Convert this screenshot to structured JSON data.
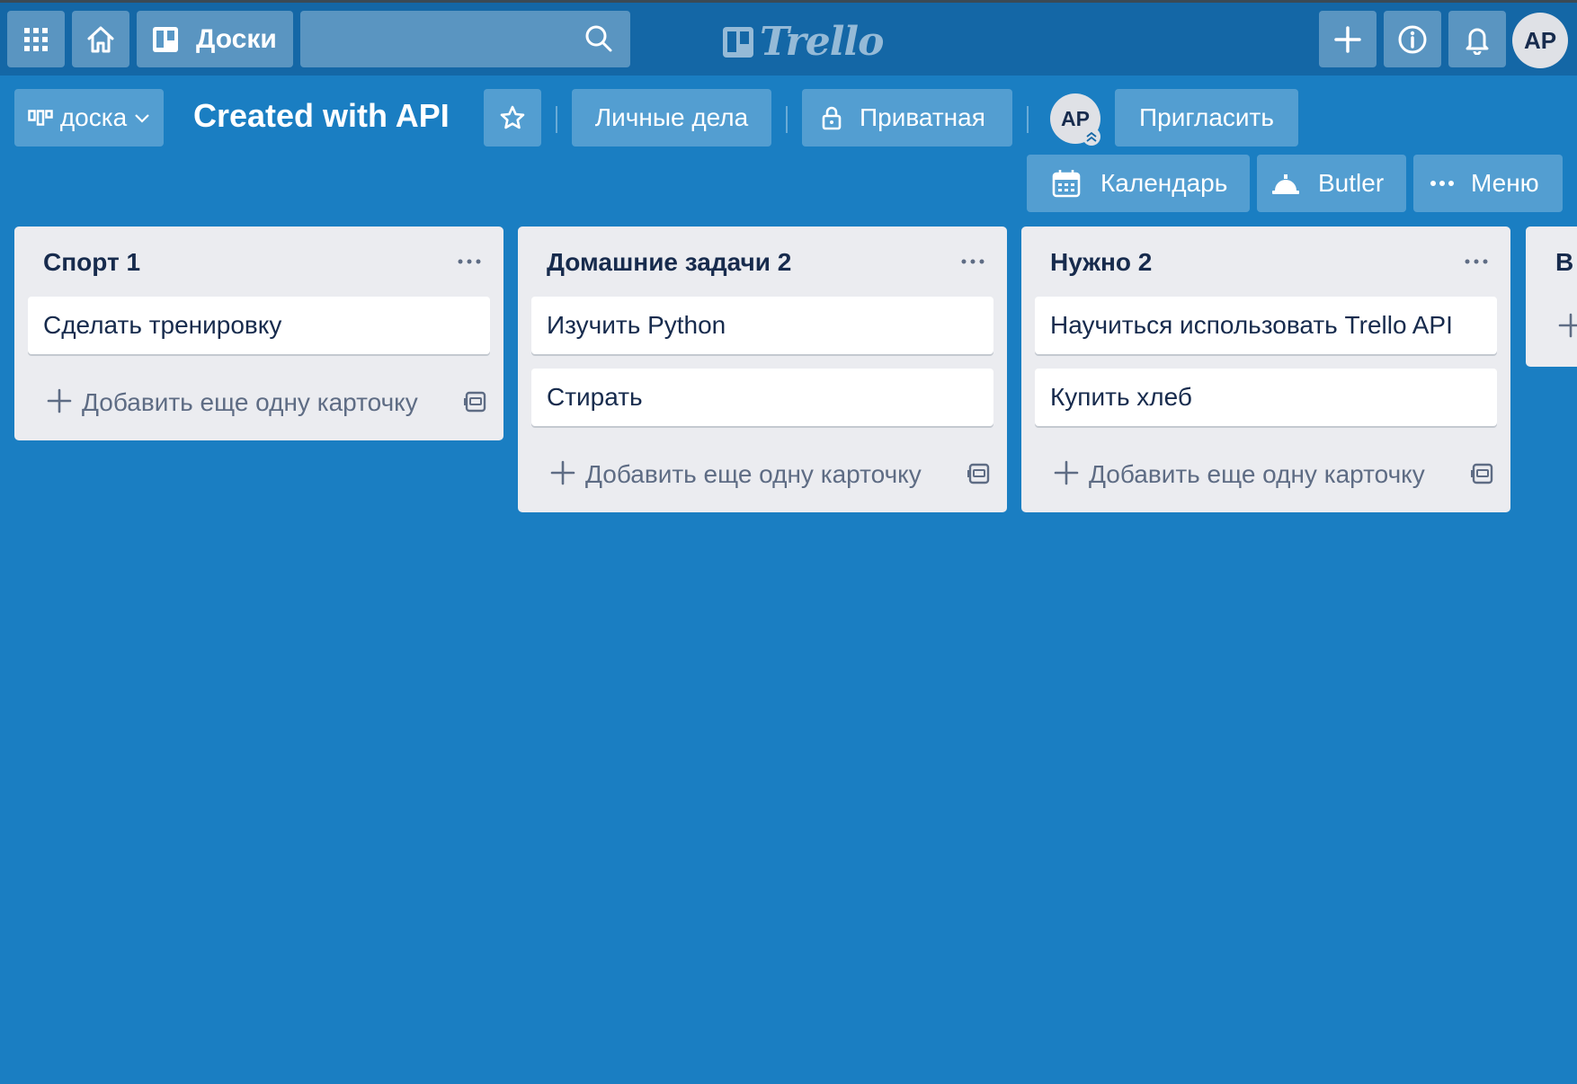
{
  "topbar": {
    "boards_label": "Доски",
    "search_value": "",
    "logo_text": "Trello",
    "user_initials": "AP"
  },
  "board": {
    "switcher_label": "доска",
    "title": "Created with API",
    "team_label": "Личные дела",
    "visibility_label": "Приватная",
    "member_initials": "AP",
    "invite_label": "Пригласить",
    "calendar_label": "Календарь",
    "butler_label": "Butler",
    "menu_label": "Меню"
  },
  "lists": [
    {
      "title": "Спорт 1",
      "cards": [
        "Сделать тренировку"
      ],
      "add_label": "Добавить еще одну карточку"
    },
    {
      "title": "Домашние задачи 2",
      "cards": [
        "Изучить Python",
        "Стирать"
      ],
      "add_label": "Добавить еще одну карточку"
    },
    {
      "title": "Нужно 2",
      "cards": [
        "Научиться использовать Trello API",
        "Купить хлеб"
      ],
      "add_label": "Добавить еще одну карточку"
    },
    {
      "title": "В"
    }
  ],
  "colors": {
    "board_background": "#1a7ec2",
    "topbar": "#1467a6",
    "list_background": "#ebecf0"
  }
}
